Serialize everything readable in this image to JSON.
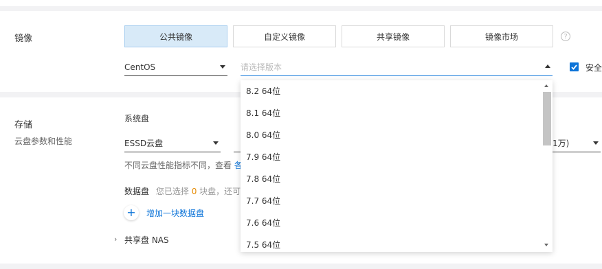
{
  "image_section": {
    "label": "镜像",
    "tabs": [
      {
        "label": "公共镜像",
        "active": true
      },
      {
        "label": "自定义镜像",
        "active": false
      },
      {
        "label": "共享镜像",
        "active": false
      },
      {
        "label": "镜像市场",
        "active": false
      }
    ],
    "help_glyph": "?",
    "os_select": "CentOS",
    "version_placeholder": "请选择版本",
    "security_checkbox_label": "安全",
    "security_checked": true
  },
  "version_dropdown": {
    "options": [
      "8.2 64位",
      "8.1 64位",
      "8.0 64位",
      "7.9 64位",
      "7.8 64位",
      "7.7 64位",
      "7.6 64位",
      "7.5 64位"
    ]
  },
  "storage_section": {
    "label": "存储",
    "sublabel": "云盘参数和性能",
    "system_disk_label": "系统盘",
    "disk_type": "ESSD云盘",
    "performance_select_partial": "1万)",
    "perf_note_prefix": "不同云盘性能指标不同，查看",
    "perf_note_link": "各",
    "data_disk_label": "数据盘",
    "data_disk_prefix": "您已选择",
    "data_disk_count": "0",
    "data_disk_suffix": "块盘，还可",
    "add_data_disk": "增加一块数据盘",
    "shared_disk_label": "共享盘 NAS"
  },
  "colors": {
    "accent": "#0d74d8",
    "active_tab_bg": "#d8eaf8",
    "count_highlight": "#e68a00"
  }
}
